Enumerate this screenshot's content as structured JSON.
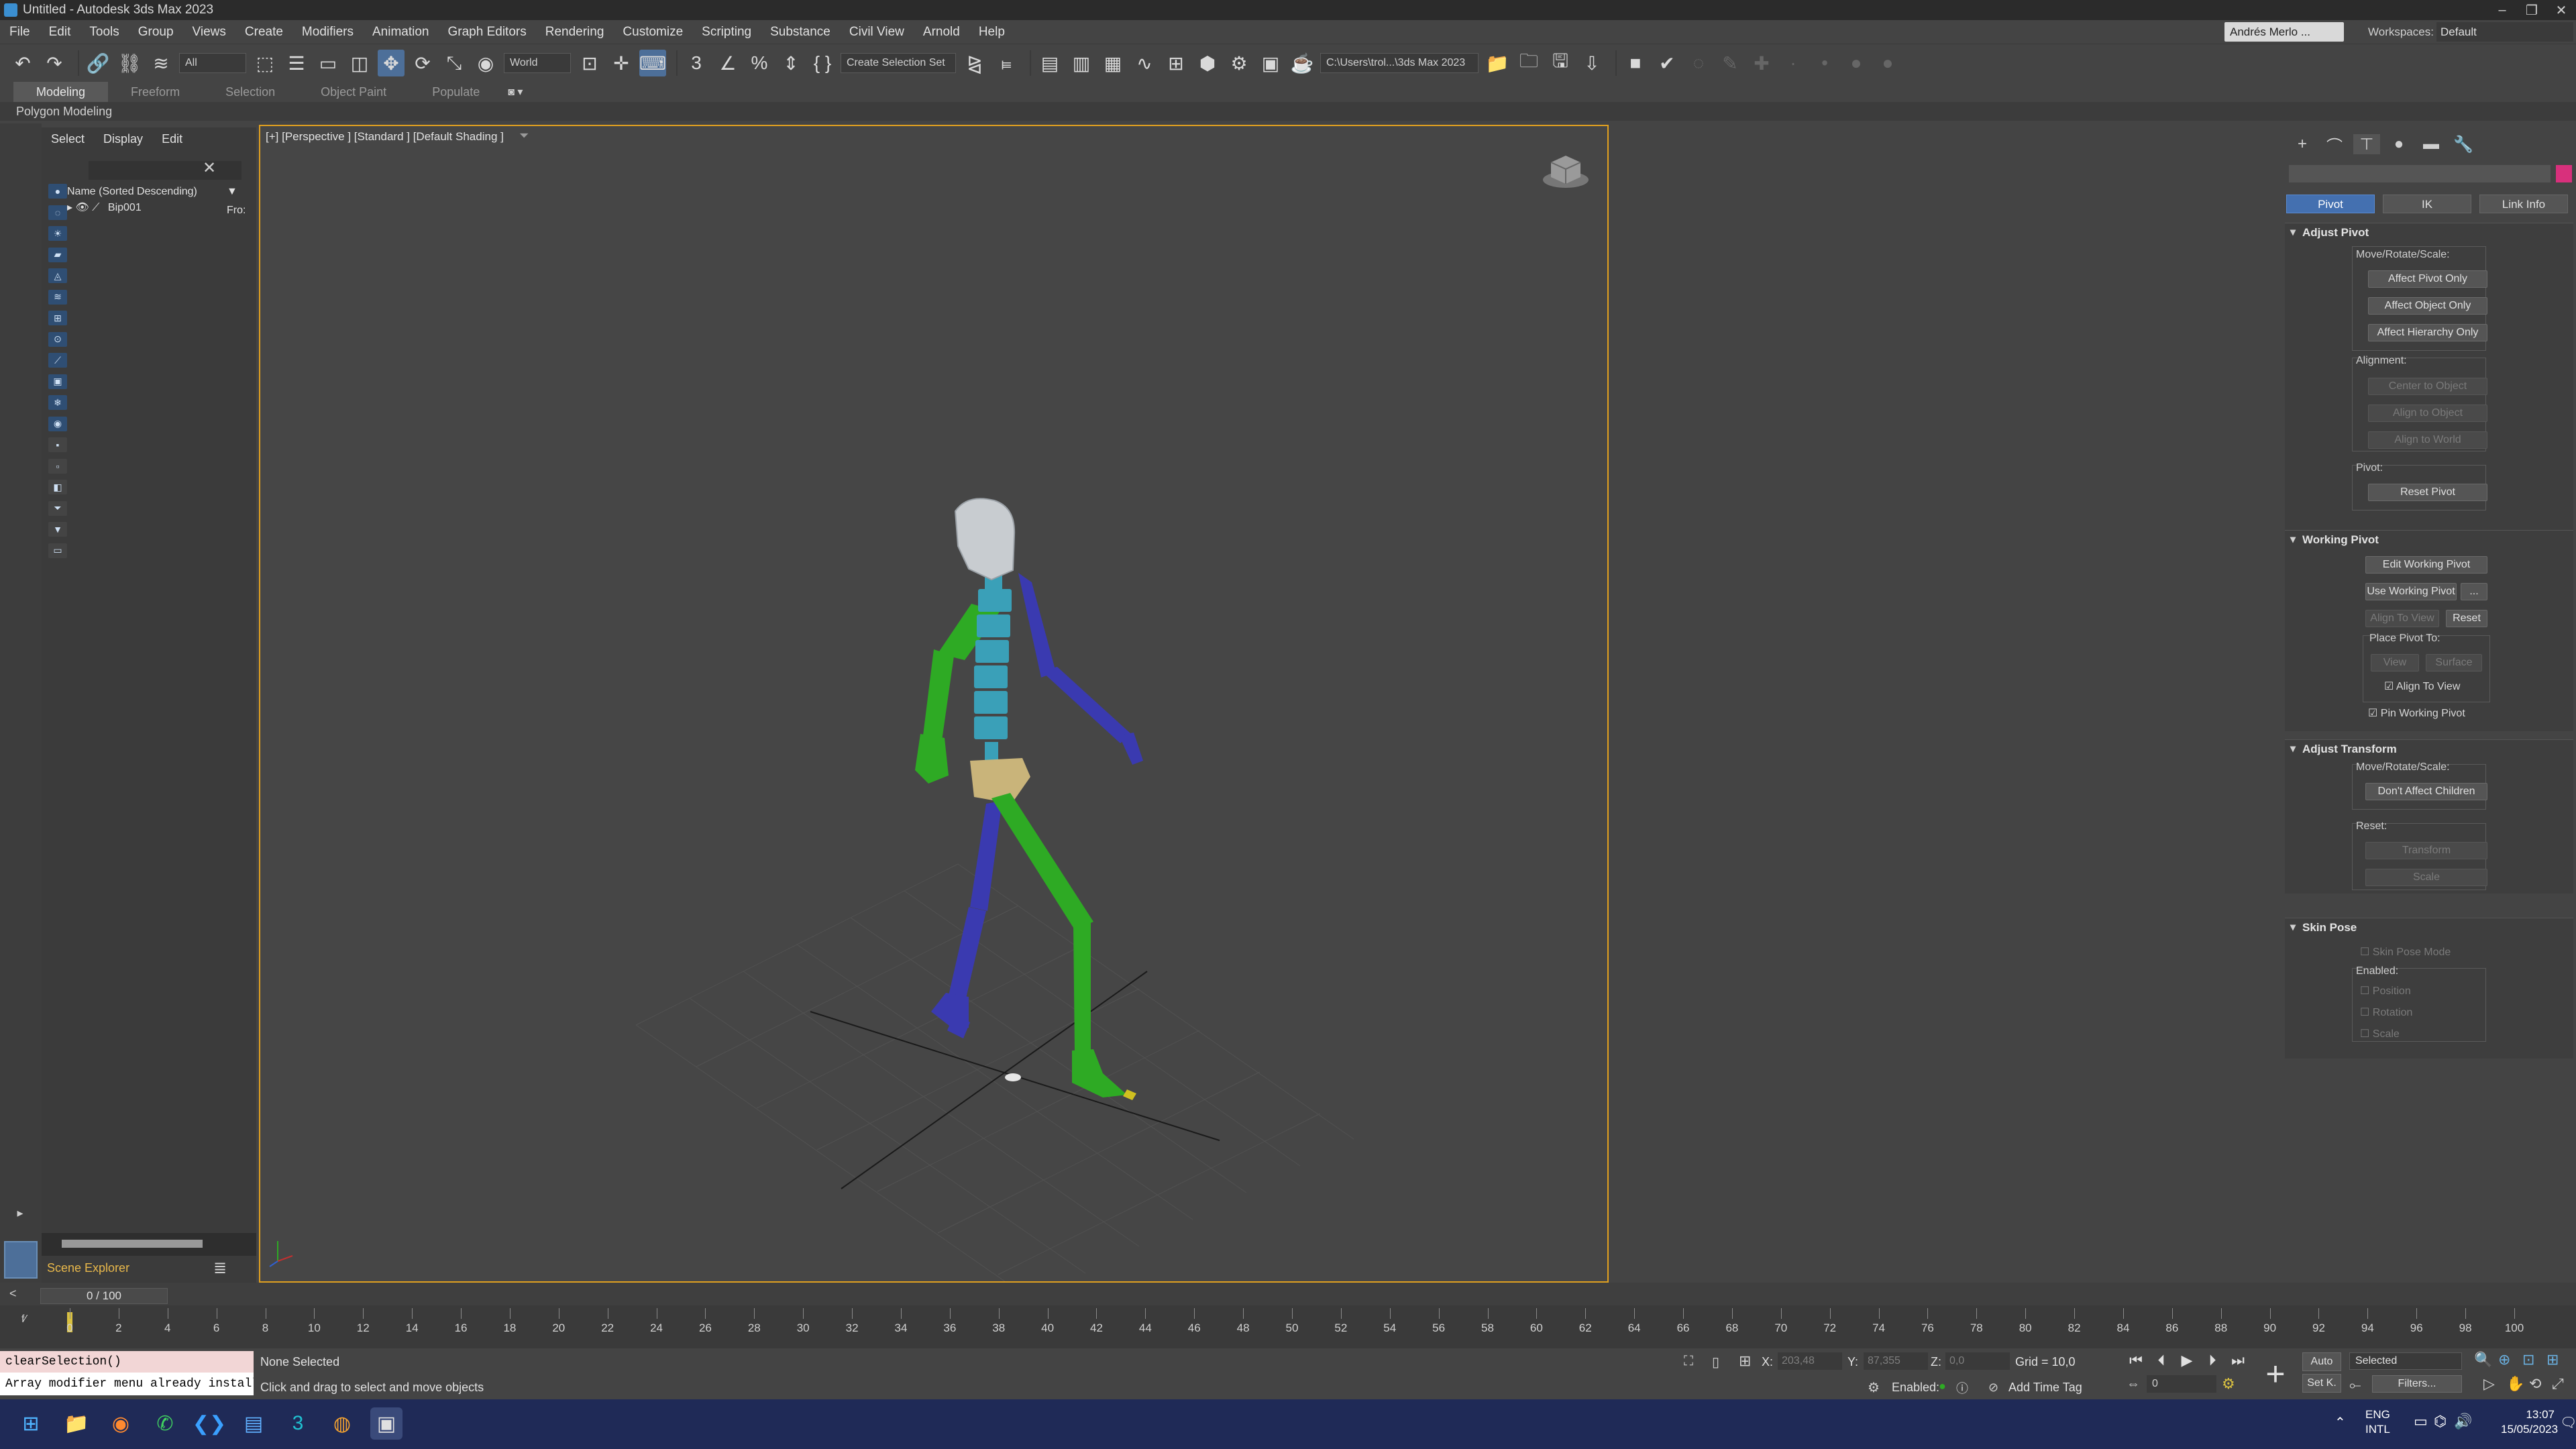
{
  "window": {
    "title": "Untitled - Autodesk 3ds Max 2023"
  },
  "menu": [
    "File",
    "Edit",
    "Tools",
    "Group",
    "Views",
    "Create",
    "Modifiers",
    "Animation",
    "Graph Editors",
    "Rendering",
    "Customize",
    "Scripting",
    "Substance",
    "Civil View",
    "Arnold",
    "Help"
  ],
  "account": {
    "user": "Andrés Merlo ...",
    "workspaces_label": "Workspaces:",
    "workspace": "Default"
  },
  "toolbar": {
    "filter": "All",
    "coord_system": "World",
    "selection_set": "Create Selection Set",
    "project_path": "C:\\Users\\trol...\\3ds Max 2023"
  },
  "ribbon": {
    "tabs": [
      "Modeling",
      "Freeform",
      "Selection",
      "Object Paint",
      "Populate"
    ],
    "active_tab": "Modeling",
    "panel": "Polygon Modeling"
  },
  "scene_explorer": {
    "tabs": [
      "Select",
      "Display",
      "Edit"
    ],
    "column_header": "Name (Sorted Descending)",
    "column_extra": "▼ Fro:",
    "item": "Bip001",
    "label": "Scene Explorer"
  },
  "viewport": {
    "label": "[+] [Perspective ] [Standard ] [Default Shading ]"
  },
  "command_panel": {
    "tabs": [
      "Pivot",
      "IK",
      "Link Info"
    ],
    "active_tab": "Pivot",
    "adjust_pivot": {
      "title": "Adjust Pivot",
      "move_label": "Move/Rotate/Scale:",
      "buttons": [
        "Affect Pivot Only",
        "Affect Object Only",
        "Affect Hierarchy Only"
      ],
      "alignment_label": "Alignment:",
      "align_buttons": [
        "Center to Object",
        "Align to Object",
        "Align to World"
      ],
      "pivot_label": "Pivot:",
      "reset_pivot": "Reset Pivot"
    },
    "working_pivot": {
      "title": "Working Pivot",
      "edit": "Edit Working Pivot",
      "use": "Use Working Pivot",
      "dots": "...",
      "align_to_view": "Align To View",
      "reset": "Reset",
      "place_label": "Place Pivot To:",
      "view": "View",
      "surface": "Surface",
      "chk_align": "Align To View",
      "chk_pin": "Pin Working Pivot"
    },
    "adjust_transform": {
      "title": "Adjust Transform",
      "move_label": "Move/Rotate/Scale:",
      "dont_affect": "Don't Affect Children",
      "reset_label": "Reset:",
      "transform": "Transform",
      "scale": "Scale"
    },
    "skin_pose": {
      "title": "Skin Pose",
      "mode": "Skin Pose Mode",
      "enabled_label": "Enabled:",
      "position": "Position",
      "rotation": "Rotation",
      "scale": "Scale"
    }
  },
  "timeline": {
    "frame_display": "0 / 100",
    "ticks": [
      "0",
      "2",
      "4",
      "6",
      "8",
      "10",
      "12",
      "14",
      "16",
      "18",
      "20",
      "22",
      "24",
      "26",
      "28",
      "30",
      "32",
      "34",
      "36",
      "38",
      "40",
      "42",
      "44",
      "46",
      "48",
      "50",
      "52",
      "54",
      "56",
      "58",
      "60",
      "62",
      "64",
      "66",
      "68",
      "70",
      "72",
      "74",
      "76",
      "78",
      "80",
      "82",
      "84",
      "86",
      "88",
      "90",
      "92",
      "94",
      "96",
      "98",
      "100"
    ]
  },
  "status": {
    "script_line1": "clearSelection()",
    "script_line2": "Array modifier menu already installe",
    "selection": "None Selected",
    "prompt": "Click and drag to select and move objects",
    "x_label": "X:",
    "x_value": "203,48",
    "y_label": "Y:",
    "y_value": "87,355",
    "z_label": "Z:",
    "z_value": "0,0",
    "grid": "Grid = 10,0",
    "enabled": "Enabled:",
    "add_time_tag": "Add Time Tag",
    "auto_key": "Auto",
    "set_key": "Set K.",
    "key_mode": "Selected",
    "filters": "Filters...",
    "frame": "0"
  },
  "tray": {
    "lang1": "ENG",
    "lang2": "INTL",
    "time": "13:07",
    "date": "15/05/2023"
  },
  "colors": {
    "viewport_border": "#e0a020",
    "active_tab": "#4470b0",
    "taskbar": "#1f2a57",
    "bone_green": "#2eaa24",
    "bone_blue": "#3a3ab0",
    "bone_cyan": "#3aa0b8",
    "pelvis": "#c9b47a",
    "head": "#c8ccd0"
  }
}
